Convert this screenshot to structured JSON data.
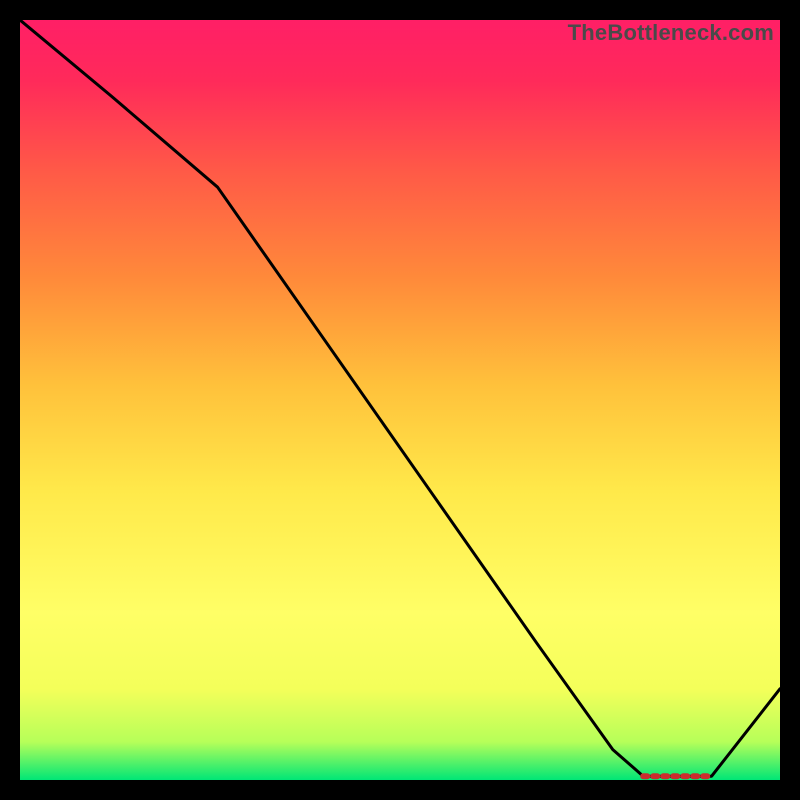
{
  "watermark": "TheBottleneck.com",
  "chart_data": {
    "type": "line",
    "title": "",
    "xlabel": "",
    "ylabel": "",
    "xlim": [
      0,
      100
    ],
    "ylim": [
      0,
      100
    ],
    "x": [
      0,
      12,
      26,
      40,
      54,
      68,
      78,
      82,
      85,
      88,
      91,
      100
    ],
    "values": [
      100,
      90,
      78,
      58,
      38,
      18,
      4,
      0.5,
      0.5,
      0.5,
      0.5,
      12
    ],
    "notes": "Single black line; background is a vertical heat gradient green→yellow→red. A short red dashed segment sits on the valley floor between x≈82 and x≈91 at y≈0.5."
  },
  "colors": {
    "line": "#000000",
    "valley_marker": "#cc2d2d",
    "bg_top": "#ff1f66",
    "bg_bottom": "#00e676"
  }
}
